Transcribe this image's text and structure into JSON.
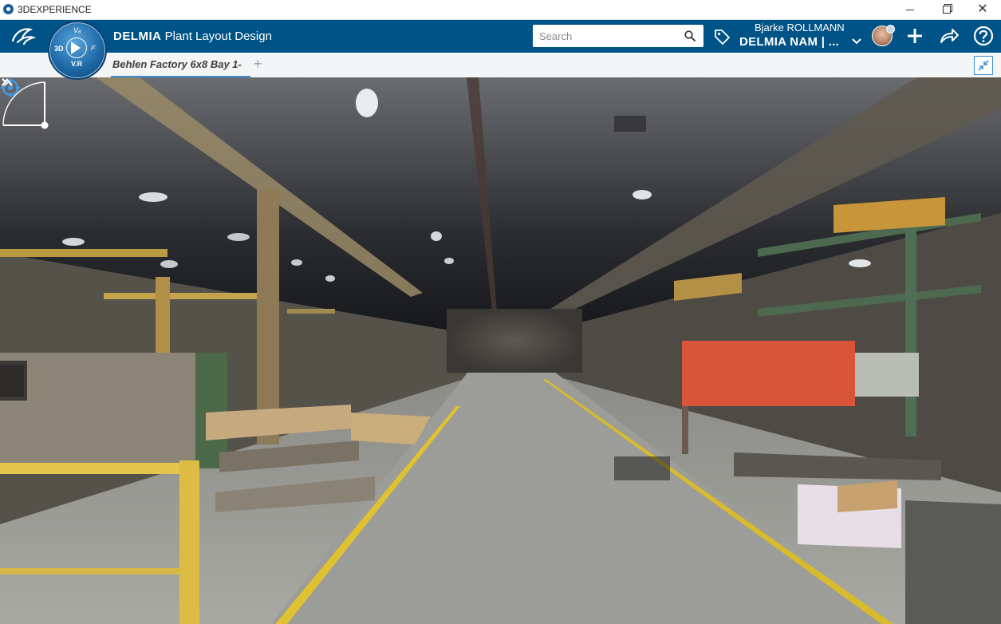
{
  "window": {
    "title": "3DEXPERIENCE",
    "icon": "3dexperience-app-icon"
  },
  "topbar": {
    "logo": "ds-logo-icon",
    "compass": {
      "label_3d": "3D",
      "label_vr": "V.R",
      "label_top": "V₆",
      "label_right": "i²"
    },
    "app_brand": "DELMIA",
    "app_name": "Plant Layout Design",
    "search": {
      "placeholder": "Search",
      "value": ""
    },
    "user": {
      "name": "Bjarke ROLLMANN",
      "tenant": "DELMIA NAM | ..."
    },
    "colors": {
      "bar": "#005386",
      "accent": "#3d8fd1"
    }
  },
  "tabbar": {
    "tabs": [
      {
        "label": "Behlen Factory 6x8 Bay 1-",
        "active": true
      }
    ],
    "add_label": "+"
  },
  "viewport": {
    "content": "point-cloud-factory-scene"
  }
}
